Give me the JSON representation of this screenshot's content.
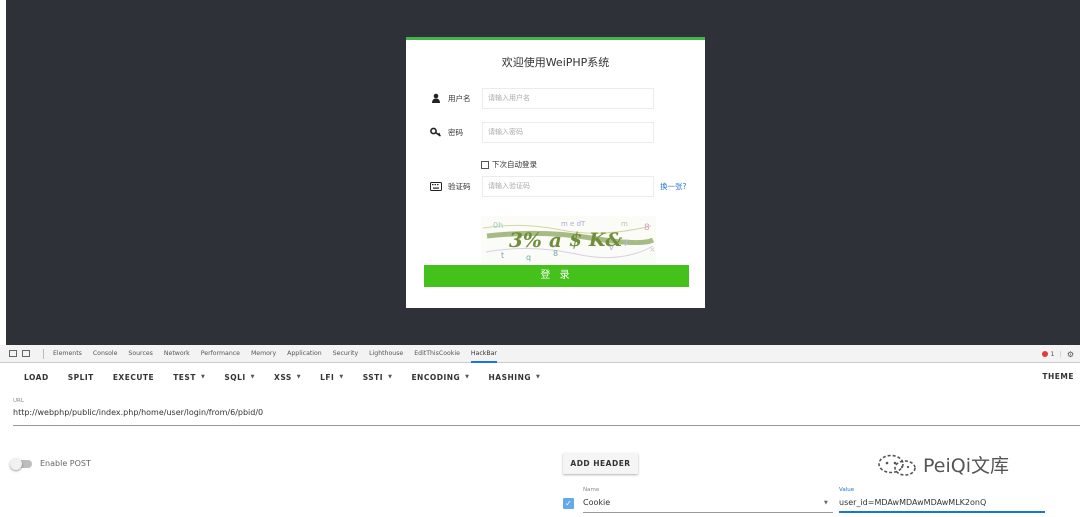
{
  "login": {
    "title": "欢迎使用WeiPHP系统",
    "username_label": "用户名",
    "username_placeholder": "请输入用户名",
    "password_label": "密码",
    "password_placeholder": "请输入密码",
    "remember_label": "下次自动登录",
    "captcha_label": "验证码",
    "captcha_placeholder": "请输入验证码",
    "refresh_link": "换一张?",
    "submit_label": "登 录"
  },
  "devtools": {
    "tabs": [
      "Elements",
      "Console",
      "Sources",
      "Network",
      "Performance",
      "Memory",
      "Application",
      "Security",
      "Lighthouse",
      "EditThisCookie",
      "HackBar"
    ],
    "active_tab": "HackBar",
    "error_count": "1"
  },
  "hackbar": {
    "load": "LOAD",
    "split": "SPLIT",
    "execute": "EXECUTE",
    "test": "TEST",
    "sqli": "SQLI",
    "xss": "XSS",
    "lfi": "LFI",
    "ssti": "SSTI",
    "encoding": "ENCODING",
    "hashing": "HASHING",
    "theme": "THEME",
    "url_label": "URL",
    "url_value": "http://webphp/public/index.php/home/user/login/from/6/pbid/0",
    "enable_post": "Enable POST",
    "add_header": "ADD HEADER",
    "header": {
      "name_label": "Name",
      "name_value": "Cookie",
      "value_label": "Value",
      "value_value": "user_id=MDAwMDAwMDAwMLK2onQ"
    }
  },
  "watermark": "PeiQi文库",
  "colors": {
    "page_bg": "#2f3139",
    "accent_green": "#44c11a",
    "link_blue": "#2a7bd5",
    "devtools_blue": "#1976d2"
  }
}
